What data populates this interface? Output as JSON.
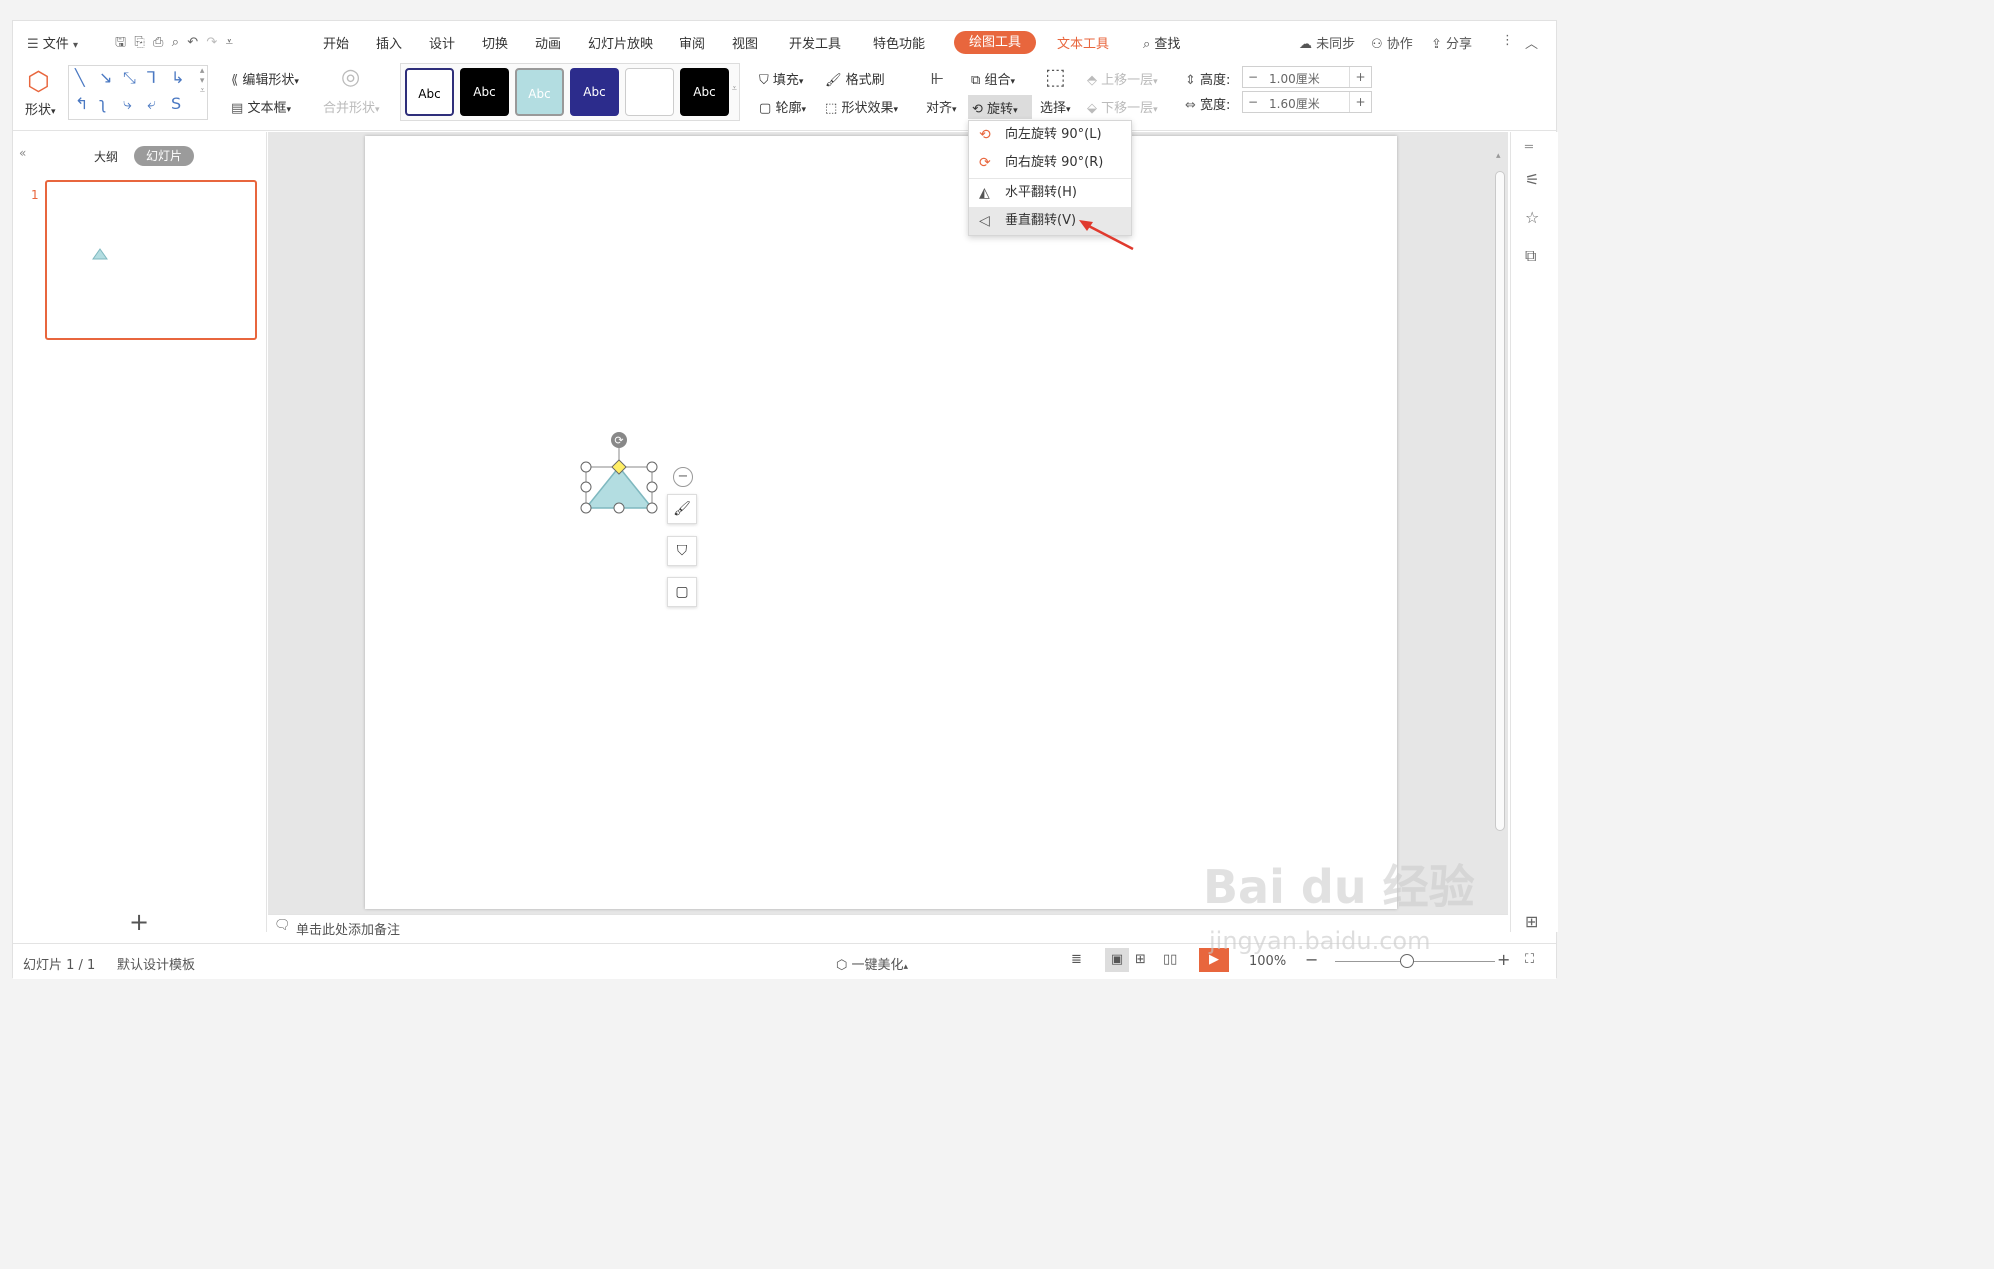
{
  "menu": {
    "file": "文件",
    "tabs": [
      "开始",
      "插入",
      "设计",
      "切换",
      "动画",
      "幻灯片放映",
      "审阅",
      "视图",
      "开发工具",
      "特色功能"
    ],
    "drawing_tools": "绘图工具",
    "text_tools": "文本工具",
    "search": "查找",
    "sync": "未同步",
    "collab": "协作",
    "share": "分享"
  },
  "ribbon": {
    "shape": "形状",
    "edit_shape": "编辑形状",
    "text_box": "文本框",
    "merge_shape": "合并形状",
    "style_label": "Abc",
    "fill": "填充",
    "format_painter": "格式刷",
    "outline": "轮廓",
    "shape_effect": "形状效果",
    "align": "对齐",
    "group": "组合",
    "rotate": "旋转",
    "select": "选择",
    "bring_forward": "上移一层",
    "send_backward": "下移一层",
    "height_label": "高度:",
    "height_value": "1.00厘米",
    "width_label": "宽度:",
    "width_value": "1.60厘米",
    "minus": "−",
    "plus": "+"
  },
  "rotate_menu": {
    "items": [
      {
        "label": "向左旋转 90°(L)"
      },
      {
        "label": "向右旋转 90°(R)"
      },
      {
        "label": "水平翻转(H)"
      },
      {
        "label": "垂直翻转(V)"
      }
    ]
  },
  "left_panel": {
    "outline": "大纲",
    "slides": "幻灯片",
    "slide_number": "1",
    "add": "+"
  },
  "notes": {
    "placeholder": "单击此处添加备注"
  },
  "status": {
    "slide_info": "幻灯片 1 / 1",
    "template": "默认设计模板",
    "beautify": "一键美化",
    "zoom": "100%"
  },
  "watermark": {
    "brand": "Bai du 经验",
    "url": "jingyan.baidu.com"
  },
  "colors": {
    "accent": "#e8663d",
    "shape_fill": "#b3dde1",
    "shape_stroke": "#7fb8bf"
  }
}
